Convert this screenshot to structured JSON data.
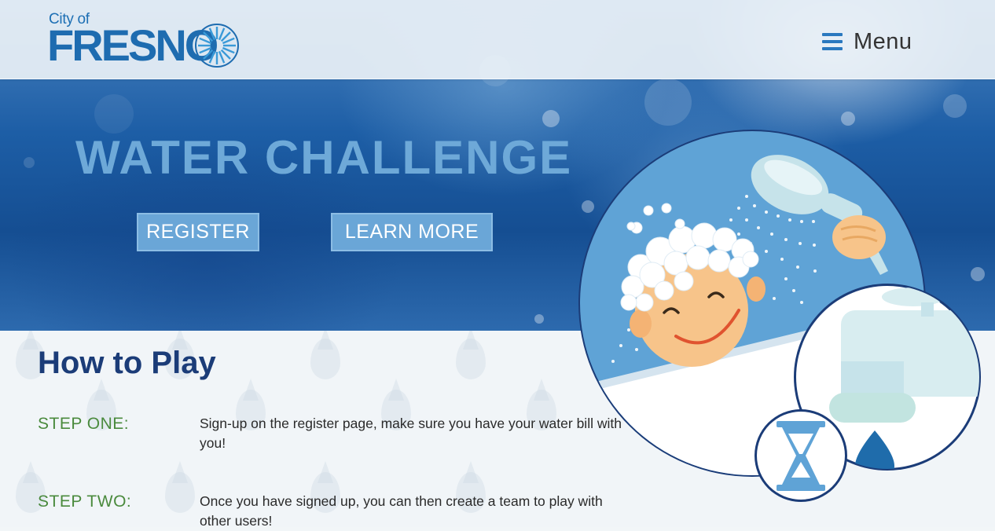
{
  "header": {
    "logo": {
      "city_text": "City of",
      "name_text": "FRESNO"
    },
    "menu_label": "Menu"
  },
  "hero": {
    "title": "WATER CHALLENGE",
    "register_label": "REGISTER",
    "learn_more_label": "LEARN MORE"
  },
  "how_to_play": {
    "title": "How to Play",
    "steps": [
      {
        "label": "STEP ONE:",
        "text": "Sign-up on the register page, make sure you have your water bill with you!"
      },
      {
        "label": "STEP TWO:",
        "text": "Once you have signed up, you can then create a team to play with other users!"
      }
    ]
  },
  "colors": {
    "brand_blue": "#1e6cb0",
    "hero_title": "#6ea9d8",
    "button_bg": "#6aa6d7",
    "heading_navy": "#1b3c78",
    "step_green": "#4a8a3d"
  },
  "icons": {
    "menu": "hamburger-icon",
    "logo_sun": "sunburst-icon",
    "illustration": "shower-illustration",
    "faucet": "faucet-icon",
    "timer": "hourglass-icon"
  }
}
